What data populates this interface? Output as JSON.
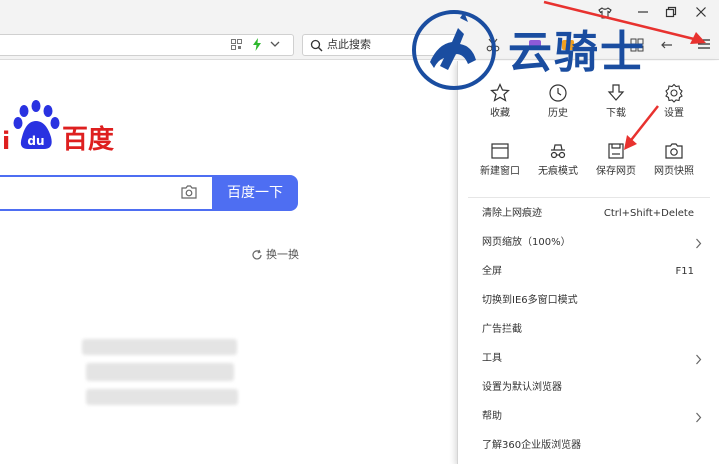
{
  "toolbar": {
    "search_placeholder": "点此搜索"
  },
  "watermark": {
    "text": "云骑士"
  },
  "baidu": {
    "logo_text": "百度",
    "logo_du": "du",
    "logo_prefix": "i",
    "search_button": "百度一下",
    "refresh_label": "换一换"
  },
  "menu": {
    "grid": [
      {
        "label": "收藏",
        "icon": "star-icon"
      },
      {
        "label": "历史",
        "icon": "clock-icon"
      },
      {
        "label": "下载",
        "icon": "download-icon"
      },
      {
        "label": "设置",
        "icon": "gear-icon"
      },
      {
        "label": "新建窗口",
        "icon": "window-icon"
      },
      {
        "label": "无痕模式",
        "icon": "incognito-icon"
      },
      {
        "label": "保存网页",
        "icon": "save-icon"
      },
      {
        "label": "网页快照",
        "icon": "camera-icon"
      }
    ],
    "items": [
      {
        "label": "清除上网痕迹",
        "shortcut": "Ctrl+Shift+Delete"
      },
      {
        "label": "网页缩放（100%）",
        "arrow": true
      },
      {
        "label": "全屏",
        "shortcut": "F11"
      },
      {
        "label": "切换到IE6多窗口模式"
      },
      {
        "label": "广告拦截"
      },
      {
        "label": "工具",
        "arrow": true
      },
      {
        "label": "设置为默认浏览器"
      },
      {
        "label": "帮助",
        "arrow": true
      },
      {
        "label": "了解360企业版浏览器"
      }
    ]
  },
  "colors": {
    "baidu_blue": "#4e6ef2",
    "baidu_red": "#de1f1f",
    "annotation_red": "#e8322f",
    "watermark_blue": "#1a4da0"
  }
}
